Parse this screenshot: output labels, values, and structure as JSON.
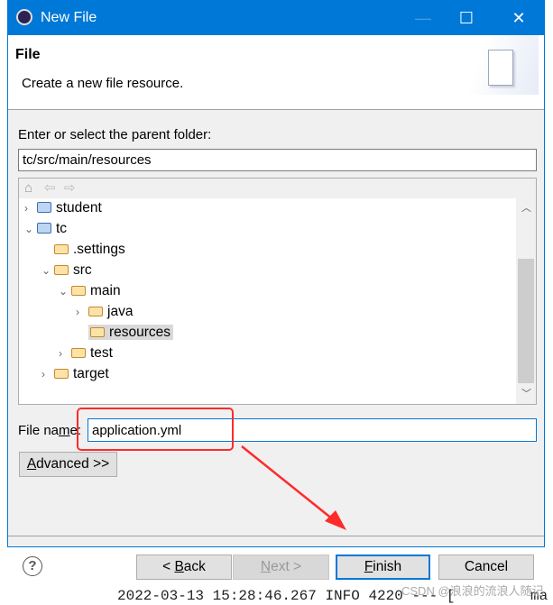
{
  "window": {
    "title": "New File",
    "minimize": "—",
    "maximize": "☐",
    "close": "✕"
  },
  "header": {
    "title": "File",
    "description": "Create a new file resource."
  },
  "parent": {
    "label": "Enter or select the parent folder:",
    "value": "tc/src/main/resources"
  },
  "tree": {
    "items": [
      {
        "label": "student",
        "depth": 0,
        "expanded": false,
        "type": "project"
      },
      {
        "label": "tc",
        "depth": 0,
        "expanded": true,
        "type": "project"
      },
      {
        "label": ".settings",
        "depth": 1,
        "expanded": null,
        "type": "folder"
      },
      {
        "label": "src",
        "depth": 1,
        "expanded": true,
        "type": "folder"
      },
      {
        "label": "main",
        "depth": 2,
        "expanded": true,
        "type": "folder"
      },
      {
        "label": "java",
        "depth": 3,
        "expanded": false,
        "type": "folder"
      },
      {
        "label": "resources",
        "depth": 3,
        "expanded": null,
        "type": "folder",
        "selected": true
      },
      {
        "label": "test",
        "depth": 2,
        "expanded": false,
        "type": "folder"
      },
      {
        "label": "target",
        "depth": 1,
        "expanded": false,
        "type": "folder"
      }
    ]
  },
  "filename": {
    "label_pre": "File na",
    "label_u": "m",
    "label_post": "e:",
    "value": "application.yml"
  },
  "advanced": {
    "u": "A",
    "rest": "dvanced >>"
  },
  "buttons": {
    "back_pre": "< ",
    "back_u": "B",
    "back_rest": "ack",
    "next_u": "N",
    "next_rest": "ext >",
    "finish_u": "F",
    "finish_rest": "inish",
    "cancel": "Cancel"
  },
  "background": {
    "log": "2022-03-13 15:28:46.267  INFO 4220 --- [",
    "log_right": "ma",
    "watermark": "CSDN @浪浪的流浪人随记"
  },
  "colors": {
    "titlebar": "#0078d7",
    "annotation": "#ff2a2a"
  }
}
